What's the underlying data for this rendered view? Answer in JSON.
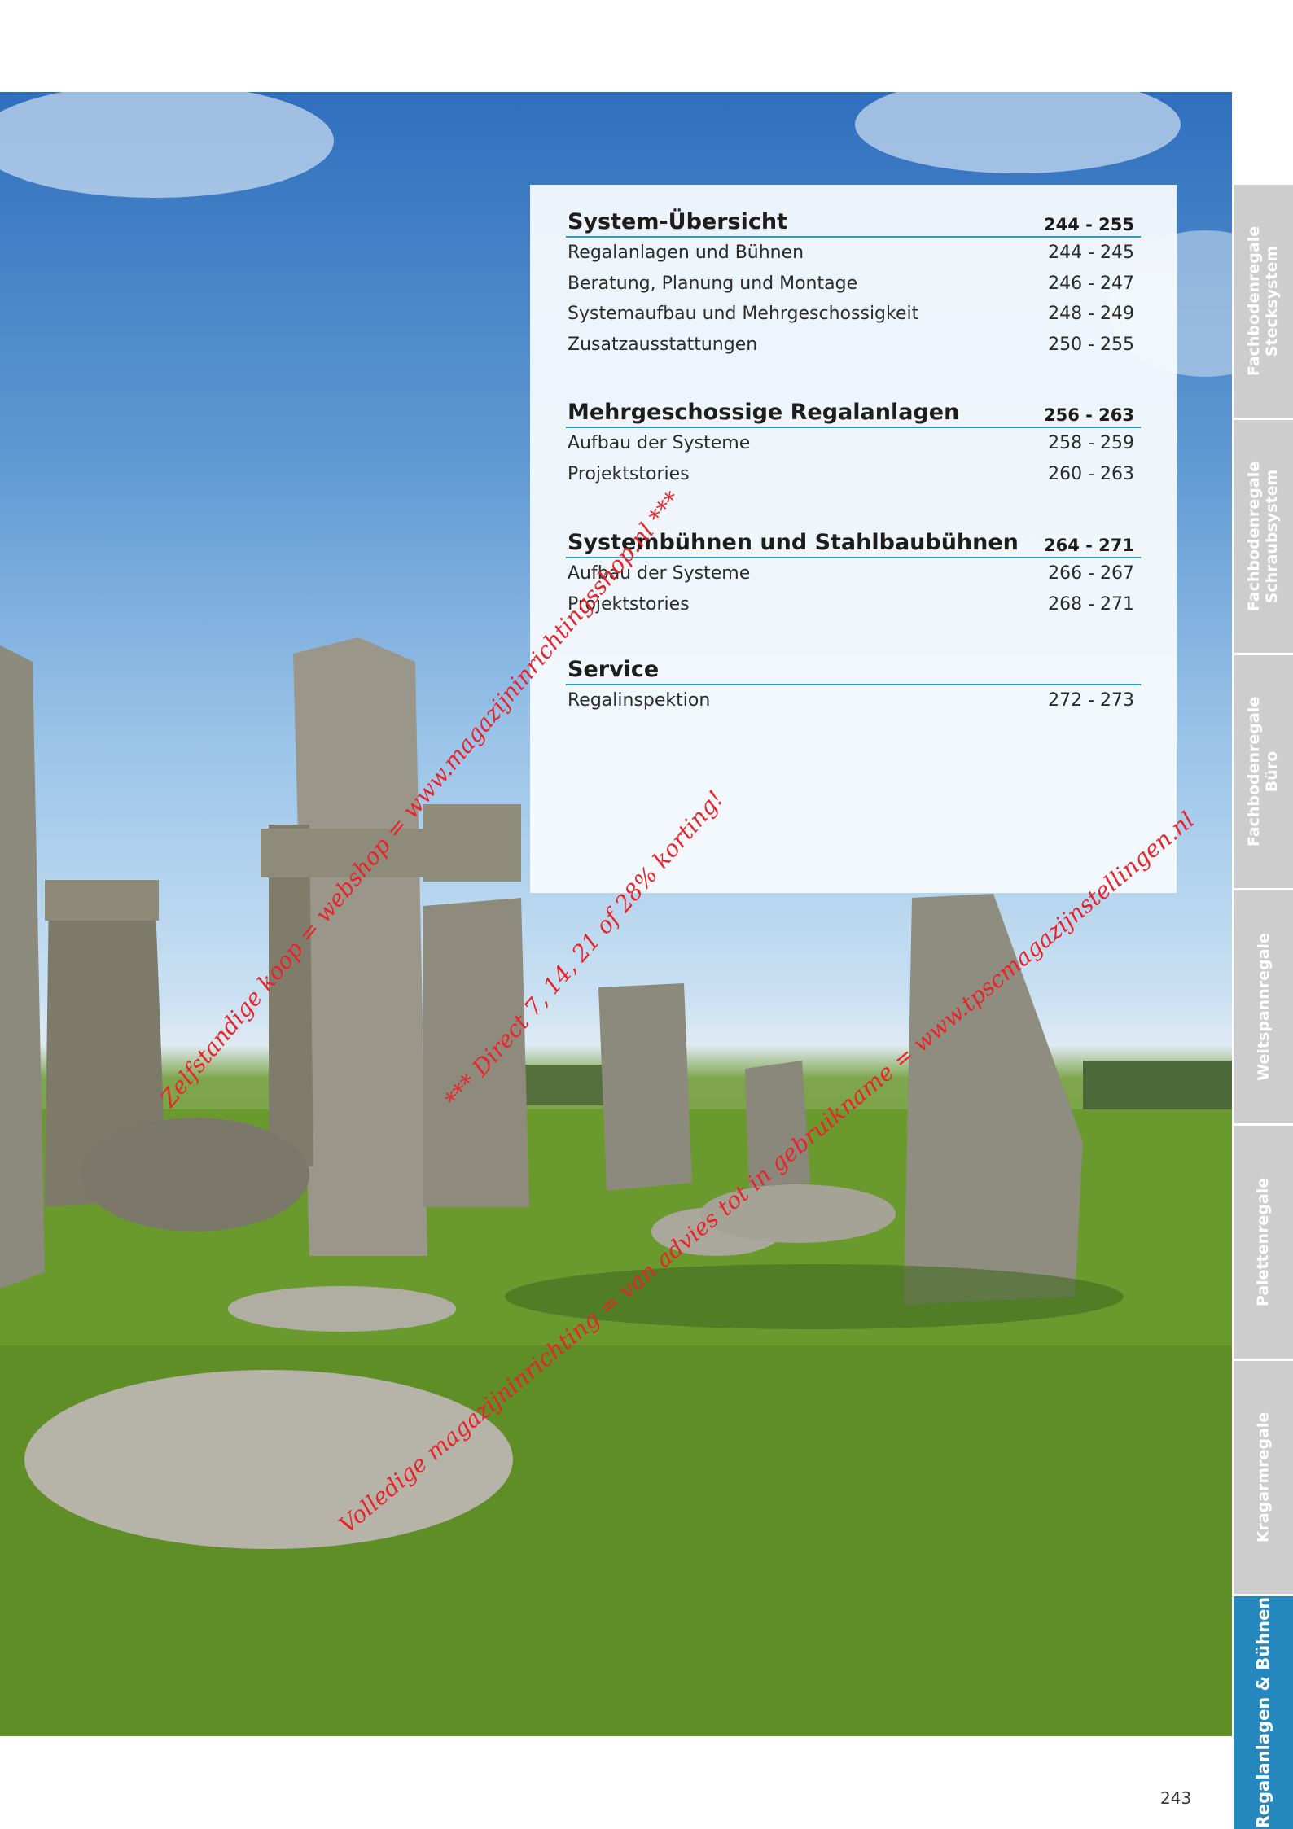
{
  "toc": {
    "sections": [
      {
        "title": "System-Übersicht",
        "range": "244 - 255",
        "items": [
          {
            "label": "Regalanlagen und Bühnen",
            "pages": "244 - 245"
          },
          {
            "label": "Beratung, Planung und Montage",
            "pages": "246 - 247"
          },
          {
            "label": "Systemaufbau und Mehrgeschossigkeit",
            "pages": "248 - 249"
          },
          {
            "label": "Zusatzausstattungen",
            "pages": "250 - 255"
          }
        ]
      },
      {
        "title": "Mehrgeschossige Regalanlagen",
        "range": "256 - 263",
        "items": [
          {
            "label": "Aufbau der Systeme",
            "pages": "258 - 259"
          },
          {
            "label": "Projektstories",
            "pages": "260 - 263"
          }
        ]
      },
      {
        "title": "Systembühnen und Stahlbaubühnen",
        "range": "264 - 271",
        "items": [
          {
            "label": "Aufbau der Systeme",
            "pages": "266 - 267"
          },
          {
            "label": "Projektstories",
            "pages": "268 - 271"
          }
        ]
      },
      {
        "title": "Service",
        "range": "",
        "items": [
          {
            "label": "Regalinspektion",
            "pages": "272 - 273"
          }
        ]
      }
    ]
  },
  "side_tabs": [
    {
      "line1": "Fachbodenregale",
      "line2": "Stecksystem",
      "active": false
    },
    {
      "line1": "Fachbodenregale",
      "line2": "Schraubsystem",
      "active": false
    },
    {
      "line1": "Fachbodenregale",
      "line2": "Büro",
      "active": false
    },
    {
      "line1": "Weitspannregale",
      "line2": "",
      "active": false
    },
    {
      "line1": "Palettenregale",
      "line2": "",
      "active": false
    },
    {
      "line1": "Kragarmregale",
      "line2": "",
      "active": false
    },
    {
      "line1": "Regalanlagen & Bühnen",
      "line2": "",
      "active": true
    }
  ],
  "page_number": "243",
  "watermarks": [
    "Zelfstandige koop = webshop = www.magazijninrichtingsshop.nl ***",
    "*** Direct 7, 14, 21 of 28% korting!",
    "Volledige magazijninrichting = van advies tot in gebruikname = www.tpscmagazijnstellingen.nl"
  ],
  "colors": {
    "accent": "#2a9bc4",
    "active_tab": "#2487bd",
    "inactive_tab": "#cdcdcd",
    "watermark": "#e8242b"
  },
  "photo": {
    "subject": "stonehenge-photo"
  }
}
